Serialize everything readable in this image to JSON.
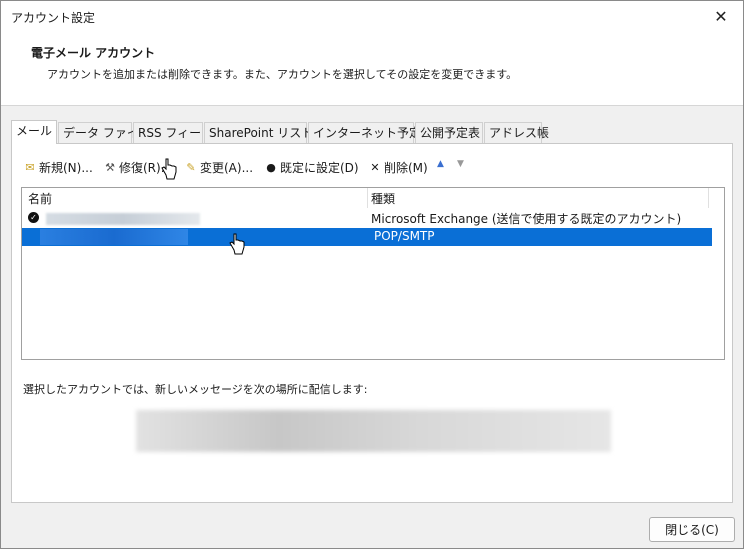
{
  "window": {
    "title": "アカウント設定"
  },
  "header": {
    "title": "電子メール アカウント",
    "description": "アカウントを追加または削除できます。また、アカウントを選択してその設定を変更できます。"
  },
  "tabs": [
    {
      "label": "メール",
      "active": true
    },
    {
      "label": "データ ファイル"
    },
    {
      "label": "RSS フィード"
    },
    {
      "label": "SharePoint リスト"
    },
    {
      "label": "インターネット予定表"
    },
    {
      "label": "公開予定表"
    },
    {
      "label": "アドレス帳"
    }
  ],
  "toolbar": {
    "new": "新規(N)...",
    "repair": "修復(R)...",
    "change": "変更(A)...",
    "set_default": "既定に設定(D)",
    "remove": "削除(M)"
  },
  "list": {
    "col_name": "名前",
    "col_type": "種類",
    "rows": [
      {
        "type": "Microsoft Exchange (送信で使用する既定のアカウント)",
        "default": true
      },
      {
        "type": "POP/SMTP",
        "selected": true
      }
    ]
  },
  "deliver_label": "選択したアカウントでは、新しいメッセージを次の場所に配信します:",
  "close_button": "閉じる(C)",
  "colors": {
    "selection": "#0a6fd6"
  }
}
